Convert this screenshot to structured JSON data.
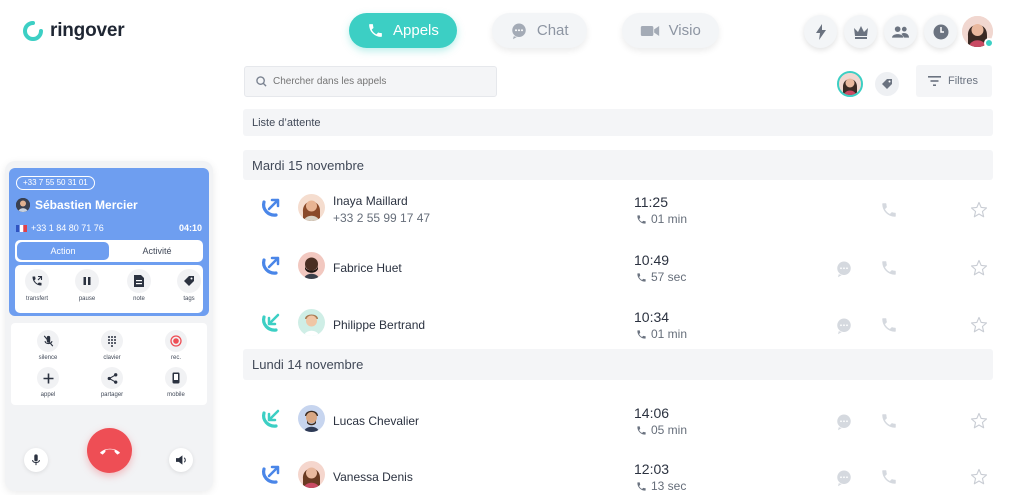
{
  "brand": {
    "name": "ringover",
    "accent": "#3ccfc4",
    "blue": "#6e9ef0",
    "red": "#ee4e55"
  },
  "nav": {
    "tabs": [
      {
        "label": "Appels",
        "icon": "phone-icon",
        "active": true
      },
      {
        "label": "Chat",
        "icon": "chat-icon",
        "active": false
      },
      {
        "label": "Visio",
        "icon": "video-icon",
        "active": false
      }
    ],
    "top_icons": [
      "bolt-icon",
      "crown-icon",
      "team-icon",
      "clock-icon",
      "avatar"
    ]
  },
  "search": {
    "placeholder": "Chercher dans les appels"
  },
  "filters": {
    "label": "Filtres"
  },
  "queue": {
    "label": "Liste d’attente"
  },
  "sections": [
    {
      "date": "Mardi 15 novembre",
      "calls": [
        {
          "direction": "outgoing",
          "name": "Inaya Maillard",
          "number": "+33 2 55 99 17 47",
          "time": "11:25",
          "duration": "01 min"
        },
        {
          "direction": "outgoing",
          "name": "Fabrice Huet",
          "number": "",
          "time": "10:49",
          "duration": "57 sec"
        },
        {
          "direction": "incoming",
          "name": "Philippe Bertrand",
          "number": "",
          "time": "10:34",
          "duration": "01 min"
        }
      ]
    },
    {
      "date": "Lundi 14 novembre",
      "calls": [
        {
          "direction": "incoming",
          "name": "Lucas Chevalier",
          "number": "",
          "time": "14:06",
          "duration": "05 min"
        },
        {
          "direction": "outgoing",
          "name": "Vanessa Denis",
          "number": "",
          "time": "12:03",
          "duration": "13 sec"
        }
      ]
    }
  ],
  "softphone": {
    "line_number": "+33 7 55 50 31 01",
    "caller_name": "Sébastien Mercier",
    "caller_number": "+33 1 84 80 71 76",
    "timer": "04:10",
    "tabs": {
      "action": "Action",
      "activity": "Activité"
    },
    "actions": [
      {
        "label": "transfert",
        "icon": "transfer-icon"
      },
      {
        "label": "pause",
        "icon": "pause-icon"
      },
      {
        "label": "note",
        "icon": "note-icon"
      },
      {
        "label": "tags",
        "icon": "tag-icon"
      }
    ],
    "controls": [
      {
        "label": "silence",
        "icon": "mute-icon"
      },
      {
        "label": "clavier",
        "icon": "keypad-icon"
      },
      {
        "label": "rec.",
        "icon": "record-icon"
      },
      {
        "label": "appel",
        "icon": "add-call-icon"
      },
      {
        "label": "partager",
        "icon": "share-icon"
      },
      {
        "label": "mobile",
        "icon": "mobile-icon"
      }
    ]
  }
}
